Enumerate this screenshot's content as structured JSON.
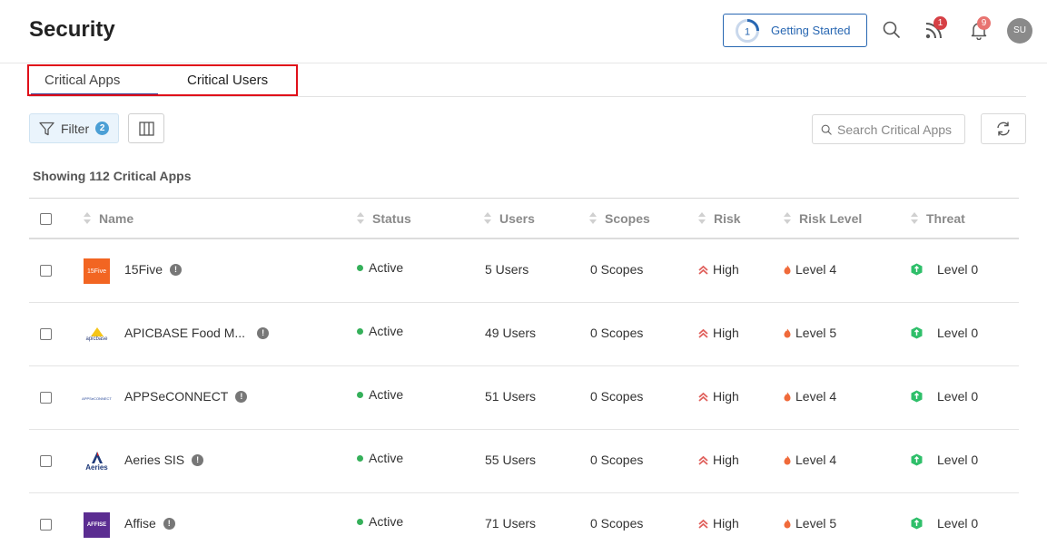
{
  "header": {
    "title": "Security",
    "getting_started": {
      "label": "Getting Started",
      "step": "1"
    },
    "feed_badge": "1",
    "notif_badge": "9",
    "avatar": "SU"
  },
  "tabs": [
    {
      "label": "Critical Apps",
      "active": true
    },
    {
      "label": "Critical Users",
      "active": false
    }
  ],
  "toolbar": {
    "filter_label": "Filter",
    "filter_count": "2",
    "search_placeholder": "Search Critical Apps"
  },
  "showing": "Showing 112 Critical Apps",
  "columns": [
    "Name",
    "Status",
    "Users",
    "Scopes",
    "Risk",
    "Risk Level",
    "Threat"
  ],
  "rows": [
    {
      "name": "15Five",
      "logo": "15Five",
      "status": "Active",
      "users": "5 Users",
      "scopes": "0 Scopes",
      "risk": "High",
      "risk_level": "Level 4",
      "threat": "Level 0"
    },
    {
      "name": "APICBASE Food M...",
      "logo": "apicbase",
      "status": "Active",
      "users": "49 Users",
      "scopes": "0 Scopes",
      "risk": "High",
      "risk_level": "Level 5",
      "threat": "Level 0"
    },
    {
      "name": "APPSeCONNECT",
      "logo": "APPSeCONNECT",
      "status": "Active",
      "users": "51 Users",
      "scopes": "0 Scopes",
      "risk": "High",
      "risk_level": "Level 4",
      "threat": "Level 0"
    },
    {
      "name": "Aeries SIS",
      "logo": "Aeries",
      "status": "Active",
      "users": "55 Users",
      "scopes": "0 Scopes",
      "risk": "High",
      "risk_level": "Level 4",
      "threat": "Level 0"
    },
    {
      "name": "Affise",
      "logo": "AFFISE",
      "status": "Active",
      "users": "71 Users",
      "scopes": "0 Scopes",
      "risk": "High",
      "risk_level": "Level 5",
      "threat": "Level 0"
    }
  ],
  "colors": {
    "accent": "#2867b2",
    "active": "#35b05a",
    "risk": "#e0605c",
    "level": "#f06a3a",
    "threat": "#2fbf6a",
    "highlight": "#e0101a"
  }
}
